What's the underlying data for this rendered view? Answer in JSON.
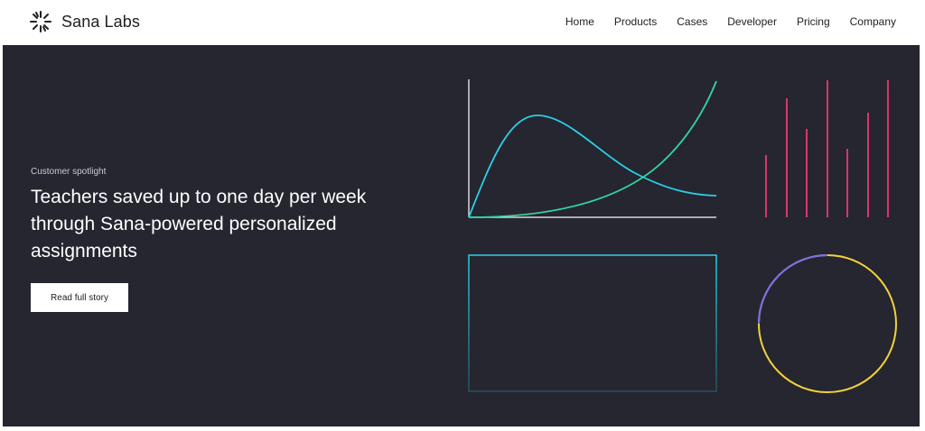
{
  "brand": {
    "name": "Sana Labs",
    "logo_icon": "sana-starburst-icon"
  },
  "nav": {
    "items": [
      {
        "label": "Home"
      },
      {
        "label": "Products"
      },
      {
        "label": "Cases"
      },
      {
        "label": "Developer"
      },
      {
        "label": "Pricing"
      },
      {
        "label": "Company"
      }
    ]
  },
  "hero": {
    "eyebrow": "Customer spotlight",
    "headline": "Teachers saved up to one day per week through Sana-powered personalized assignments",
    "cta_label": "Read full story"
  },
  "colors": {
    "hero_bg": "#252630",
    "cyan": "#2ad0e6",
    "green": "#33d69f",
    "pink": "#d9366a",
    "yellow": "#f2d13c",
    "purple": "#7a6cf0"
  }
}
